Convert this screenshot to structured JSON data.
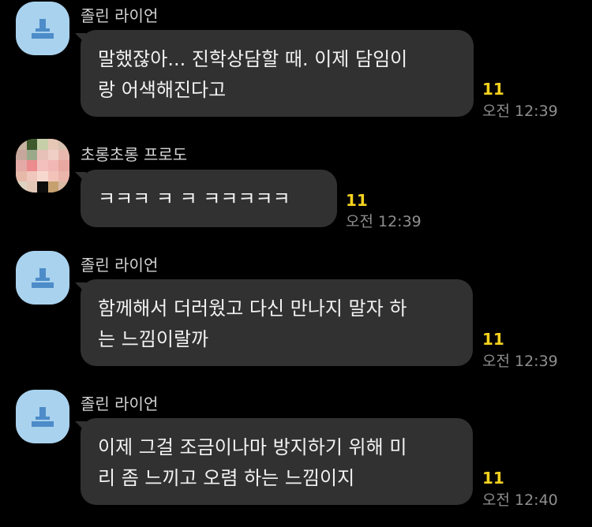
{
  "colors": {
    "background": "#000000",
    "bubble": "#313131",
    "unread": "#f4d21f",
    "meta_text": "#8e8e8e",
    "default_avatar": "#a9d2ee"
  },
  "messages": [
    {
      "sender": "졸린 라이언",
      "avatar": "default-profile-icon",
      "lines": [
        "말했잖아... 진학상담할 때. 이제 담임이",
        "랑 어색해진다고"
      ],
      "unread": "11",
      "time": "오전 12:39"
    },
    {
      "sender": "초롱초롱 프로도",
      "avatar": "pixelated-profile-photo",
      "lines": [
        "ㅋㅋㅋ ㅋ ㅋ ㅋㅋㅋㅋㅋ"
      ],
      "unread": "11",
      "time": "오전 12:39"
    },
    {
      "sender": "졸린 라이언",
      "avatar": "default-profile-icon",
      "lines": [
        "함께해서 더러웠고 다신 만나지 말자 하",
        "는 느낌이랄까"
      ],
      "unread": "11",
      "time": "오전 12:39"
    },
    {
      "sender": "졸린 라이언",
      "avatar": "default-profile-icon",
      "lines": [
        "이제 그걸 조금이나마 방지하기 위해 미",
        "리 좀 느끼고 오렴 하는 느낌이지"
      ],
      "unread": "11",
      "time": "오전 12:40"
    }
  ]
}
